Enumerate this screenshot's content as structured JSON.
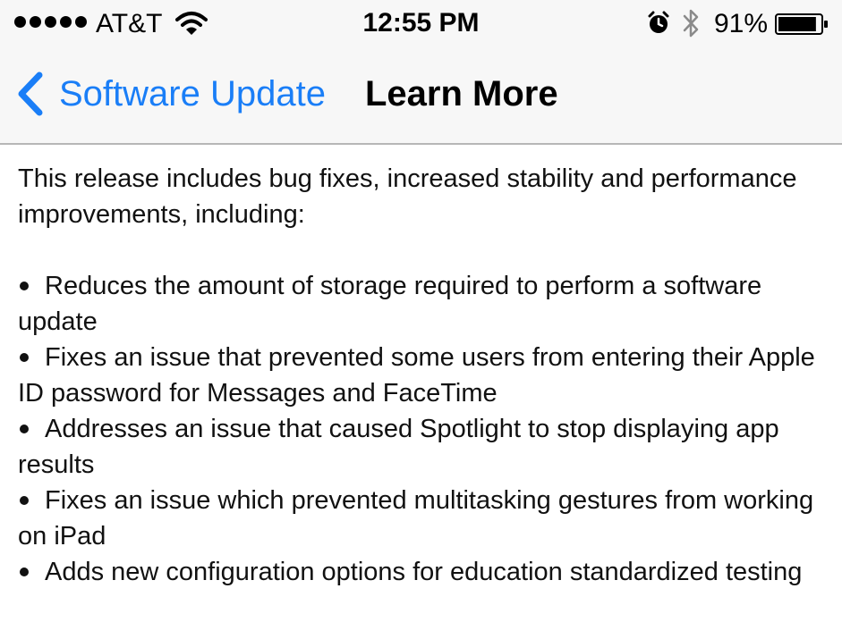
{
  "status_bar": {
    "carrier": "AT&T",
    "signal_bars": 5,
    "time": "12:55 PM",
    "battery_percent": "91%",
    "battery_level": 0.91,
    "icons": [
      "signal-dots-icon",
      "wifi-icon",
      "alarm-icon",
      "bluetooth-icon",
      "battery-icon"
    ]
  },
  "nav": {
    "back_label": "Software Update",
    "title": "Learn More",
    "accent_color": "#1a7ef7"
  },
  "content": {
    "intro": "This release includes bug fixes, increased stability and performance improvements, including:",
    "items": [
      "Reduces the amount of storage required to perform a software update",
      "Fixes an issue that prevented some users from entering their Apple ID password for Messages and FaceTime",
      "Addresses an issue that caused Spotlight to stop displaying app results",
      "Fixes an issue which prevented multitasking gestures from working on iPad",
      "Adds new configuration options for education standardized testing"
    ]
  }
}
